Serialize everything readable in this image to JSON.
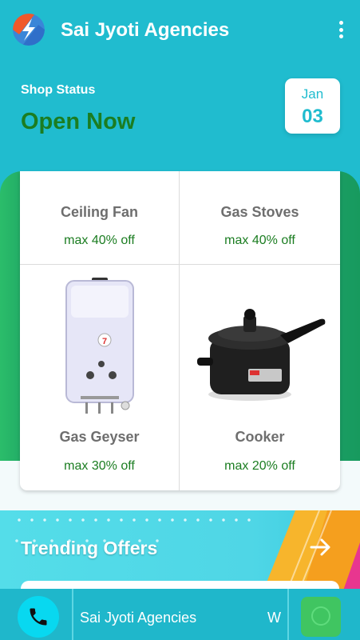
{
  "app": {
    "title": "Sai Jyoti Agencies",
    "logo_icon": "brand-logo-icon",
    "menu_icon": "more-vertical-icon"
  },
  "status": {
    "label": "Shop Status",
    "value": "Open Now",
    "date_month": "Jan",
    "date_day": "03"
  },
  "products": [
    {
      "name": "Ceiling Fan",
      "offer": "max 40% off"
    },
    {
      "name": "Gas Stoves",
      "offer": "max 40% off"
    },
    {
      "name": "Gas Geyser",
      "offer": "max 30% off",
      "image": "gas-geyser-image"
    },
    {
      "name": "Cooker",
      "offer": "max 20% off",
      "image": "pressure-cooker-image"
    }
  ],
  "trending": {
    "title": "Trending Offers",
    "arrow_icon": "arrow-right-icon"
  },
  "bottom_bar": {
    "ticker_text": "Sai Jyoti Agencies",
    "ticker_next": "W",
    "call_icon": "phone-icon",
    "chat_icon": "chat-icon"
  },
  "colors": {
    "primary": "#20bccf",
    "open_green": "#1b7d21",
    "band_green": "#1b9e64",
    "chat_green": "#40c561"
  }
}
